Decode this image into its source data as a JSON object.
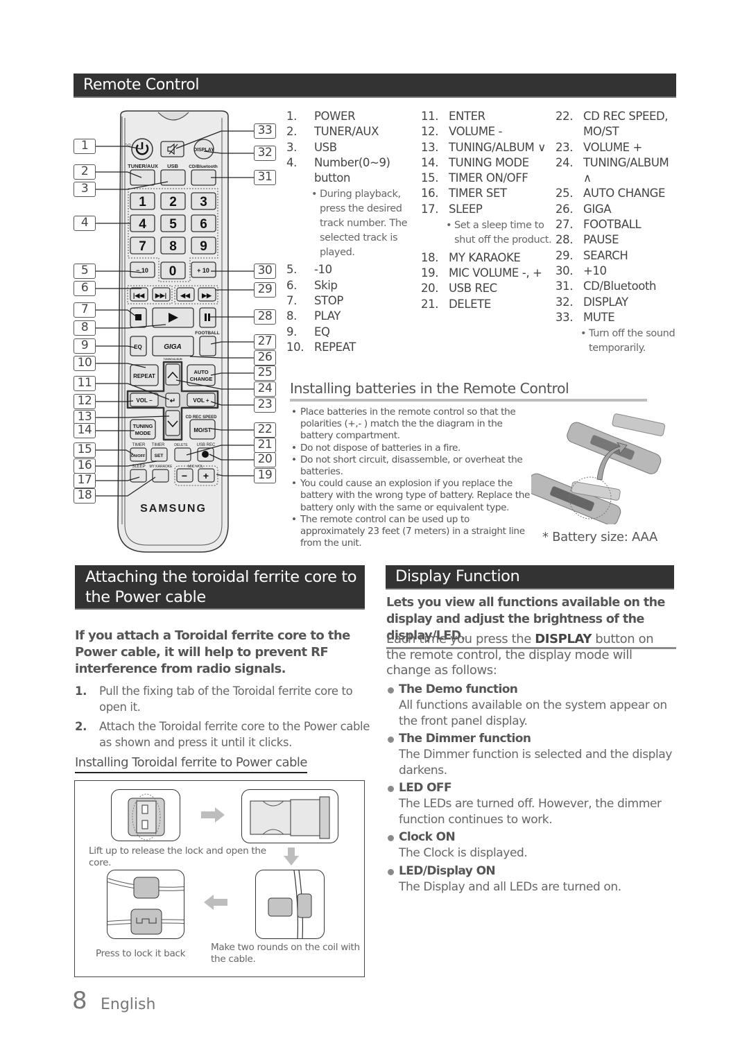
{
  "remote_section": {
    "title": "Remote Control",
    "callouts_left": [
      "1",
      "2",
      "3",
      "4",
      "5",
      "6",
      "7",
      "8",
      "9",
      "10",
      "11",
      "12",
      "13",
      "14",
      "15",
      "16",
      "17",
      "18"
    ],
    "callouts_right": [
      "33",
      "32",
      "31",
      "30",
      "29",
      "28",
      "27",
      "26",
      "25",
      "24",
      "23",
      "22",
      "21",
      "20",
      "19"
    ],
    "remote_labels": {
      "tuner_aux": "TUNER/AUX",
      "usb": "USB",
      "cd_bluetooth": "CD/Bluetooth",
      "display": "DISPLAY",
      "num_keys": [
        "1",
        "2",
        "3",
        "4",
        "5",
        "6",
        "7",
        "8",
        "9"
      ],
      "minus10": "− 10",
      "zero": "0",
      "plus10": "+ 10",
      "football": "FOOTBALL",
      "eq": "EQ",
      "giga": "GIGA",
      "tuning_album": "TUNING/ALBUM",
      "repeat": "REPEAT",
      "auto_change_1": "AUTO",
      "auto_change_2": "CHANGE",
      "vol_minus": "VOL −",
      "vol_plus": "VOL +",
      "cd_rec_speed": "CD REC SPEED",
      "tuning_mode_1": "TUNING",
      "tuning_mode_2": "MODE",
      "mo_st": "MO/ST",
      "timer1": "TIMER",
      "timer2": "TIMER",
      "delete": "DELETE",
      "usb_rec": "USB REC",
      "on_off": "ON/OFF",
      "set": "SET",
      "sleep": "SLEEP",
      "my_karaoke": "MY KARAOKE",
      "mic_vol": "MIC VOL",
      "mic_minus": "−",
      "mic_plus": "+",
      "brand": "SAMSUNG"
    },
    "buttons_col1": [
      {
        "num": "1.",
        "label": "POWER"
      },
      {
        "num": "2.",
        "label": "TUNER/AUX"
      },
      {
        "num": "3.",
        "label": "USB"
      },
      {
        "num": "4.",
        "label": "Number(0~9) button",
        "note": "During playback, press the desired track number. The selected track is played."
      },
      {
        "num": "5.",
        "label": "-10"
      },
      {
        "num": "6.",
        "label": "Skip"
      },
      {
        "num": "7.",
        "label": "STOP"
      },
      {
        "num": "8.",
        "label": "PLAY"
      },
      {
        "num": "9.",
        "label": "EQ"
      },
      {
        "num": "10.",
        "label": "REPEAT"
      }
    ],
    "buttons_col2": [
      {
        "num": "11.",
        "label": "ENTER"
      },
      {
        "num": "12.",
        "label": "VOLUME -"
      },
      {
        "num": "13.",
        "label": "TUNING/ALBUM ∨"
      },
      {
        "num": "14.",
        "label": "TUNING MODE"
      },
      {
        "num": "15.",
        "label": "TIMER ON/OFF"
      },
      {
        "num": "16.",
        "label": "TIMER SET"
      },
      {
        "num": "17.",
        "label": "SLEEP",
        "note": "Set a sleep time to shut off the product."
      },
      {
        "num": "18.",
        "label": "MY KARAOKE"
      },
      {
        "num": "19.",
        "label": "MIC VOLUME -, +"
      },
      {
        "num": "20.",
        "label": "USB REC"
      },
      {
        "num": "21.",
        "label": "DELETE"
      }
    ],
    "buttons_col3": [
      {
        "num": "22.",
        "label": "CD REC SPEED, MO/ST"
      },
      {
        "num": "23.",
        "label": "VOLUME +"
      },
      {
        "num": "24.",
        "label": "TUNING/ALBUM ∧"
      },
      {
        "num": "25.",
        "label": "AUTO CHANGE"
      },
      {
        "num": "26.",
        "label": "GIGA"
      },
      {
        "num": "27.",
        "label": "FOOTBALL"
      },
      {
        "num": "28.",
        "label": "PAUSE"
      },
      {
        "num": "29.",
        "label": "SEARCH"
      },
      {
        "num": "30.",
        "label": "+10"
      },
      {
        "num": "31.",
        "label": "CD/Bluetooth"
      },
      {
        "num": "32.",
        "label": "DISPLAY"
      },
      {
        "num": "33.",
        "label": "MUTE",
        "note": "Turn off the sound temporarily."
      }
    ]
  },
  "batteries": {
    "title": "Installing batteries in the Remote Control",
    "items": [
      "Place batteries in the remote control so that the polarities (+,- ) match the the diagram in the battery compartment.",
      "Do not dispose of batteries in a fire.",
      "Do not short circuit, disassemble, or overheat the batteries.",
      "You could cause an explosion if you replace the battery with the wrong type of battery. Replace the battery only with the same or equivalent type.",
      "The remote control can be used up to approximately 23 feet (7 meters) in a straight line from the unit."
    ],
    "battery_size": "* Battery size: AAA"
  },
  "toroidal": {
    "title": "Attaching the toroidal ferrite core to the Power cable",
    "intro": "If you attach a Toroidal ferrite core to the Power cable, it will help to prevent RF interference from radio signals.",
    "steps": [
      {
        "num": "1.",
        "text": "Pull the fixing tab of the Toroidal ferrite core to open it."
      },
      {
        "num": "2.",
        "text": "Attach the Toroidal ferrite core to the Power cable as shown and press it until it clicks."
      }
    ],
    "subtitle": "Installing Toroidal ferrite to Power cable",
    "captions": {
      "lift": "Lift up to release the lock and open the core.",
      "press": "Press to lock it back",
      "rounds": "Make two rounds on the coil with the cable."
    }
  },
  "display_function": {
    "title": "Display Function",
    "intro": "Lets you view all functions available on the display and adjust the brightness of the display/LED.",
    "lead_pre": "Each time you press the ",
    "lead_bold": "DISPLAY",
    "lead_post": " button on the remote control, the display mode will change as follows:",
    "modes": [
      {
        "title": "The Demo function",
        "desc": "All functions available on the system appear on the front panel display."
      },
      {
        "title": "The Dimmer function",
        "desc": "The Dimmer function is selected and the display darkens."
      },
      {
        "title": "LED OFF",
        "desc": "The LEDs are turned off. However, the dimmer function continues to work."
      },
      {
        "title": "Clock ON",
        "desc": "The Clock is displayed."
      },
      {
        "title": "LED/Display ON",
        "desc": "The Display and all LEDs are turned on."
      }
    ]
  },
  "footer": {
    "page_number": "8",
    "language": "English"
  }
}
